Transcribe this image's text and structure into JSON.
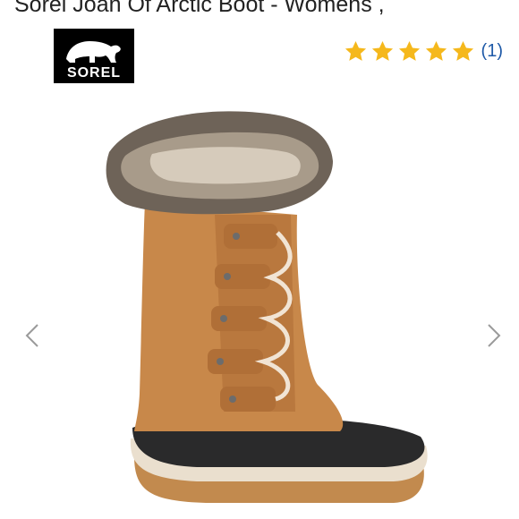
{
  "product": {
    "title": "Sorel Joan Of Arctic Boot - Womens ,",
    "brand_logo_text": "SOREL",
    "rating": {
      "value": 5,
      "max": 5,
      "count_label": "(1)",
      "star_color": "#f5b81c"
    },
    "image": {
      "icon": "winter-boot-image"
    }
  },
  "carousel": {
    "prev_icon": "chevron-left-icon",
    "next_icon": "chevron-right-icon"
  }
}
